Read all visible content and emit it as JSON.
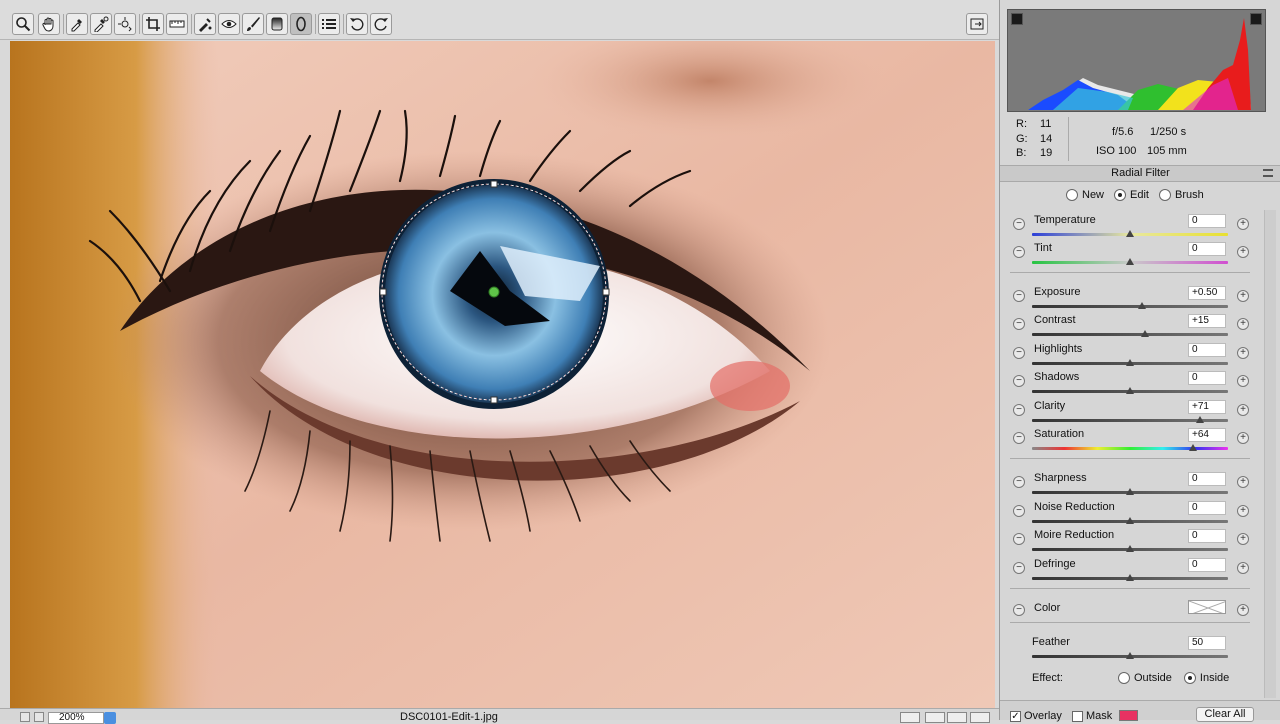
{
  "toolbar": {
    "tools": [
      "zoom-icon",
      "hand-icon",
      "white-balance-icon",
      "color-sampler-icon",
      "targeted-adjustment-icon",
      "crop-icon",
      "straighten-icon",
      "spot-removal-icon",
      "red-eye-icon",
      "adjustment-brush-icon",
      "graduated-filter-icon",
      "radial-filter-icon",
      "list-icon",
      "rotate-left-icon",
      "rotate-right-icon"
    ],
    "active_tool": "radial-filter-icon"
  },
  "info": {
    "r_label": "R:",
    "r_value": "11",
    "g_label": "G:",
    "g_value": "14",
    "b_label": "B:",
    "b_value": "19",
    "aperture": "f/5.6",
    "shutter": "1/250 s",
    "iso": "ISO 100",
    "focal": "105 mm"
  },
  "panel": {
    "title": "Radial Filter",
    "modes": [
      {
        "label": "New",
        "selected": false
      },
      {
        "label": "Edit",
        "selected": true
      },
      {
        "label": "Brush",
        "selected": false
      }
    ],
    "sliders": [
      {
        "label": "Temperature",
        "value": "0",
        "pos": 0.5,
        "track": "temperature"
      },
      {
        "label": "Tint",
        "value": "0",
        "pos": 0.5,
        "track": "tint"
      },
      {
        "label": "Exposure",
        "value": "+0.50",
        "pos": 0.56,
        "track": "neutral"
      },
      {
        "label": "Contrast",
        "value": "+15",
        "pos": 0.575,
        "track": "neutral"
      },
      {
        "label": "Highlights",
        "value": "0",
        "pos": 0.5,
        "track": "neutral"
      },
      {
        "label": "Shadows",
        "value": "0",
        "pos": 0.5,
        "track": "neutral"
      },
      {
        "label": "Clarity",
        "value": "+71",
        "pos": 0.855,
        "track": "neutral"
      },
      {
        "label": "Saturation",
        "value": "+64",
        "pos": 0.82,
        "track": "saturation"
      },
      {
        "label": "Sharpness",
        "value": "0",
        "pos": 0.5,
        "track": "neutral"
      },
      {
        "label": "Noise Reduction",
        "value": "0",
        "pos": 0.5,
        "track": "neutral"
      },
      {
        "label": "Moire Reduction",
        "value": "0",
        "pos": 0.5,
        "track": "neutral"
      },
      {
        "label": "Defringe",
        "value": "0",
        "pos": 0.5,
        "track": "neutral"
      }
    ],
    "color_label": "Color",
    "feather_label": "Feather",
    "feather_value": "50",
    "feather_pos": 0.5,
    "effect_label": "Effect:",
    "effect_options": [
      {
        "label": "Outside",
        "selected": false
      },
      {
        "label": "Inside",
        "selected": true
      }
    ]
  },
  "footer": {
    "overlay_label": "Overlay",
    "overlay_checked": true,
    "mask_label": "Mask",
    "mask_checked": false,
    "mask_color": "#e83262",
    "clear_all_label": "Clear All"
  },
  "status": {
    "zoom": "200%",
    "filename": "DSC0101-Edit-1.jpg"
  },
  "colors": {
    "accent": "#4a8fe0",
    "panel_bg": "#d6d6d6",
    "iris": "#3f7fb5",
    "skin": "#e8b9a4"
  }
}
